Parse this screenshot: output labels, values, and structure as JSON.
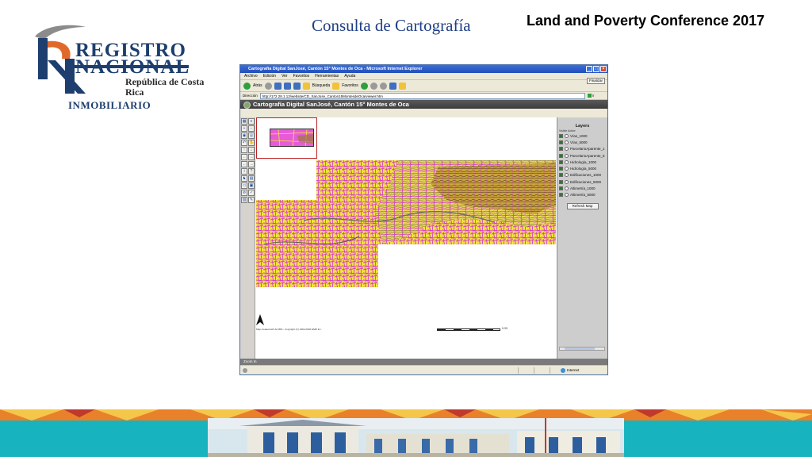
{
  "logo": {
    "line1": "REGISTRO",
    "line2": "NACIONAL",
    "line3": "República de Costa Rica",
    "line4": "INMOBILIARIO"
  },
  "slide": {
    "title": "Consulta de Cartografía",
    "conference": "Land and Poverty Conference 2017"
  },
  "browser": {
    "window_title": "Cartografía Digital SanJosé, Cantón 15° Montes de Oca - Microsoft Internet Explorer",
    "menu": [
      "Archivo",
      "Edición",
      "Ver",
      "Favoritos",
      "Herramientas",
      "Ayuda"
    ],
    "finalize_label": "Finalizar",
    "toolbar": {
      "back": "Atrás",
      "search": "Búsqueda",
      "favorites": "Favoritos"
    },
    "address_label": "Dirección",
    "address_value": "http://172.28.1.12/website/CD_SanJose_Canton15MontesdeOca/viewer.htm",
    "go_label": "Ir",
    "zone_label": "Internet"
  },
  "app": {
    "header": "Cartografía Digital SanJosé, Cantón 15° Montes de Oca",
    "status": "Zoom In",
    "copyright": "Map created with ArcIMS - Copyright (C) 1992-2002 ESRI Inc.",
    "layers": {
      "title": "Layers",
      "active_label": "Visible Active",
      "items": [
        {
          "name": "Vías_1000",
          "visible": true
        },
        {
          "name": "Vías_5000",
          "visible": true
        },
        {
          "name": "ParcelarioAparente_1",
          "visible": true
        },
        {
          "name": "ParcelarioAparente_5",
          "visible": true
        },
        {
          "name": "Hidrología_1000",
          "visible": true
        },
        {
          "name": "Hidrología_5000",
          "visible": true
        },
        {
          "name": "Edificaciones_1000",
          "visible": true
        },
        {
          "name": "Edificaciones_5000",
          "visible": true
        },
        {
          "name": "Altimetría_1000",
          "visible": true
        },
        {
          "name": "Altimetría_5000",
          "visible": true
        }
      ],
      "refresh_label": "Refresh Map"
    },
    "scale_label": "0.33"
  },
  "colors": {
    "map_yellow": "#f2e43a",
    "map_magenta": "#d63bd3",
    "map_olive": "#8a7a2a",
    "title_blue": "#1f3e86",
    "footer_orange": "#e9812a",
    "footer_teal": "#17b3be"
  }
}
